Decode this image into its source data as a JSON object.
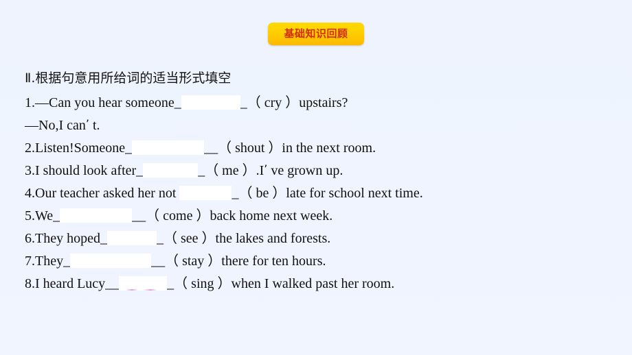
{
  "badge": {
    "label": "基础知识回顾"
  },
  "colors": {
    "background": "#eef4fe",
    "badge_top": "#ffd900",
    "badge_bottom": "#fcb900",
    "badge_text": "#d42b12",
    "body_text": "#101010",
    "blank_fill": "#ffffff"
  },
  "section": {
    "title": "Ⅱ.根据句意用所给词的适当形式填空"
  },
  "questions": [
    {
      "number": "1.",
      "before": "1.—Can you hear someone_",
      "blank_width": 86,
      "after": "_（ cry ）upstairs?",
      "cue": "cry"
    },
    {
      "number": "",
      "before": "—No,I can",
      "blank_width": 0,
      "apostrophe": "’",
      "after": " t.",
      "cue": ""
    },
    {
      "number": "2.",
      "before": "2.Listen!Someone_",
      "blank_width": 105,
      "after": "__（ shout ）in the next room.",
      "cue": "shout"
    },
    {
      "number": "3.",
      "before": "3.I should look after_",
      "blank_width": 80,
      "after": "_（ me ）.I",
      "apostrophe": "’",
      "tail": " ve grown up.",
      "cue": "me"
    },
    {
      "number": "4.",
      "before": "4.Our teacher asked her not ",
      "blank_width": 76,
      "after": "_（ be ）late for school next time.",
      "cue": "be"
    },
    {
      "number": "5.",
      "before": "5.We_",
      "blank_width": 105,
      "after": "__（ come ）back home next week.",
      "cue": "come"
    },
    {
      "number": "6.",
      "before": "6.They hoped_",
      "blank_width": 72,
      "after": "_（ see ）the lakes and forests.",
      "cue": "see"
    },
    {
      "number": "7.",
      "before": "7.They_",
      "blank_width": 118,
      "after": "__（ stay ）there for ten hours.",
      "cue": "stay"
    },
    {
      "number": "8.",
      "before": "8.I heard Lucy__",
      "blank_width": 70,
      "after": "_（ sing ）when I walked past her room.",
      "cue": "sing",
      "tinted": true
    }
  ]
}
